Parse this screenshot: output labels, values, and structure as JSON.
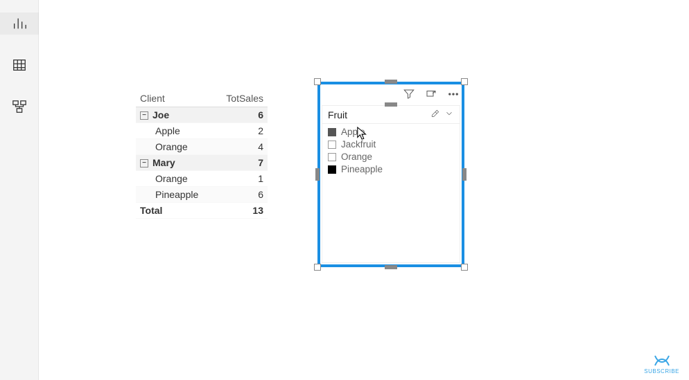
{
  "leftbar": {
    "items": [
      {
        "name": "report-view",
        "active": true
      },
      {
        "name": "data-view",
        "active": false
      },
      {
        "name": "model-view",
        "active": false
      }
    ]
  },
  "matrix": {
    "headers": {
      "client": "Client",
      "totsales": "TotSales"
    },
    "groups": [
      {
        "name": "Joe",
        "subtotal": 6,
        "rows": [
          {
            "label": "Apple",
            "value": 2
          },
          {
            "label": "Orange",
            "value": 4
          }
        ]
      },
      {
        "name": "Mary",
        "subtotal": 7,
        "rows": [
          {
            "label": "Orange",
            "value": 1
          },
          {
            "label": "Pineapple",
            "value": 6
          }
        ]
      }
    ],
    "total": {
      "label": "Total",
      "value": 13
    }
  },
  "slicer": {
    "title": "Fruit",
    "items": [
      {
        "label": "Apple",
        "state": "partial"
      },
      {
        "label": "Jackfruit",
        "state": "unchecked"
      },
      {
        "label": "Orange",
        "state": "unchecked"
      },
      {
        "label": "Pineapple",
        "state": "checked"
      }
    ]
  },
  "footer": {
    "subscribe": "SUBSCRIBE"
  }
}
